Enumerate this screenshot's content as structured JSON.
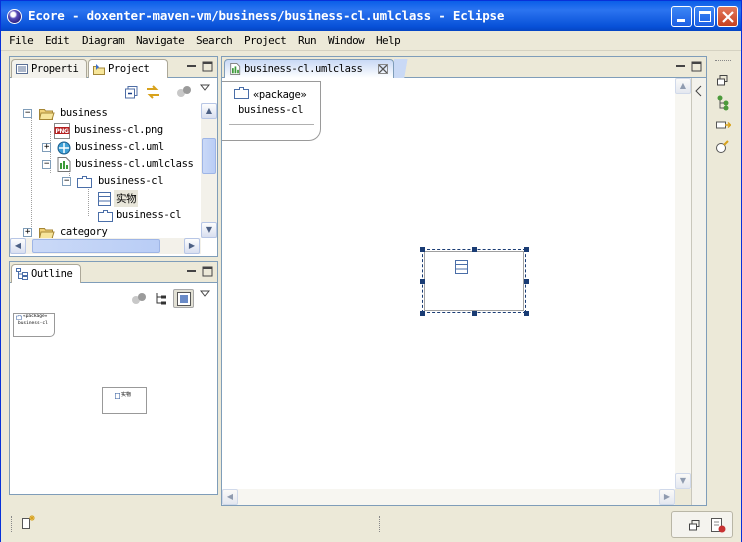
{
  "window": {
    "title": "Ecore - doxenter-maven-vm/business/business-cl.umlclass - Eclipse"
  },
  "menu": [
    "File",
    "Edit",
    "Diagram",
    "Navigate",
    "Search",
    "Project",
    "Run",
    "Window",
    "Help"
  ],
  "left_tabs": {
    "properties": "Properti",
    "project": "Project"
  },
  "tree": [
    {
      "label": "business",
      "icon": "folder-open-icon",
      "expander": "−"
    },
    {
      "label": "business-cl.png",
      "icon": "png-file-icon",
      "expander": ""
    },
    {
      "label": "business-cl.uml",
      "icon": "uml-model-icon",
      "expander": "+"
    },
    {
      "label": "business-cl.umlclass",
      "icon": "umlclass-diagram-icon",
      "expander": "−"
    },
    {
      "label": "business-cl",
      "icon": "package-icon",
      "expander": "−"
    },
    {
      "label": "实物",
      "icon": "class-icon",
      "expander": ""
    },
    {
      "label": "business-cl",
      "icon": "package-icon",
      "expander": ""
    },
    {
      "label": "category",
      "icon": "folder-icon",
      "expander": "+"
    }
  ],
  "outline": {
    "title": "Outline",
    "mini_package_stereotype": "«package»",
    "mini_package_name": "business-cl",
    "mini_class_name": "实物"
  },
  "editor": {
    "tab_label": "business-cl.umlclass",
    "package_stereotype": "«package»",
    "package_name": "business-cl"
  },
  "colors": {
    "title_bar": "#0a5ee8",
    "selection_handle": "#1a3c74",
    "panel_border": "#7f9db9"
  }
}
